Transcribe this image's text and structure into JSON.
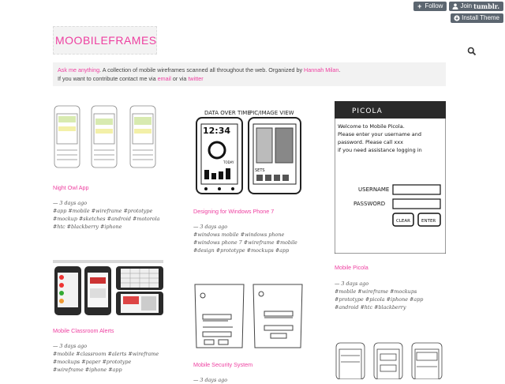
{
  "toolbar": {
    "follow": "Follow",
    "join_prefix": "Join",
    "join_brand": "tumblr.",
    "install_theme": "Install Theme"
  },
  "blog": {
    "logo_text": "MOOBILEFRAMES",
    "ask_link": "Ask me anything",
    "desc_mid": ". A collection of mobile wireframes scanned all throughout the web. Organized by",
    "author_link": "Hannah Milan",
    "desc_line2": "If you want to contribute contact me via",
    "email_link": "email",
    "or_text": "or via",
    "twitter_link": "twitter"
  },
  "posts": [
    {
      "title": "Night Owl App",
      "date": "— 3 days ago",
      "tags": "#app  #mobile  #wireframe  #prototype  #mockup  #sketches  #android  #motorola  #htc  #blackberry  #iphone"
    },
    {
      "title": "Mobile Classroom Alerts",
      "date": "— 3 days ago",
      "tags": "#mobile  #classroom  #alerts  #wireframe  #mockups  #paper  #prototype  #wireframe  #iphone  #app"
    },
    {
      "title": "Designing for Windows Phone 7",
      "date": "— 3 days ago",
      "tags": "#windows mobile  #windows phone  #windows phone 7  #wireframe  #mobile  #design  #prototype  #mockups  #app"
    },
    {
      "title": "Mobile Security System",
      "date": "— 3 days ago",
      "tags": ""
    },
    {
      "title": "Mobile Picola",
      "date": "— 3 days ago",
      "tags": "#mobile  #wireframe  #mockups  #prototype  #picola  #iphone  #app  #android  #htc  #blackberry"
    }
  ],
  "sketch_text": {
    "wp7_date_label": "DATA OVER TIME",
    "wp7_pic_label": "PIC/IMAGE VIEW",
    "wp7_time": "12:34",
    "wp7_today": "TODAY",
    "wp7_sets": "SETS",
    "picola_header": "PICOLA",
    "picola_welcome": "Welcome to Mobile Picola.",
    "picola_line2": "Please enter your username and",
    "picola_line3": "password. Please call xxx",
    "picola_line4": "if you need assistance logging in",
    "picola_username": "USERNAME",
    "picola_password": "PASSWORD",
    "picola_clear": "CLEAR",
    "picola_enter": "ENTER"
  },
  "colors": {
    "accent": "#ee3fa0",
    "button_bg": "#5c6670",
    "desc_bg": "#f2f2f2"
  }
}
